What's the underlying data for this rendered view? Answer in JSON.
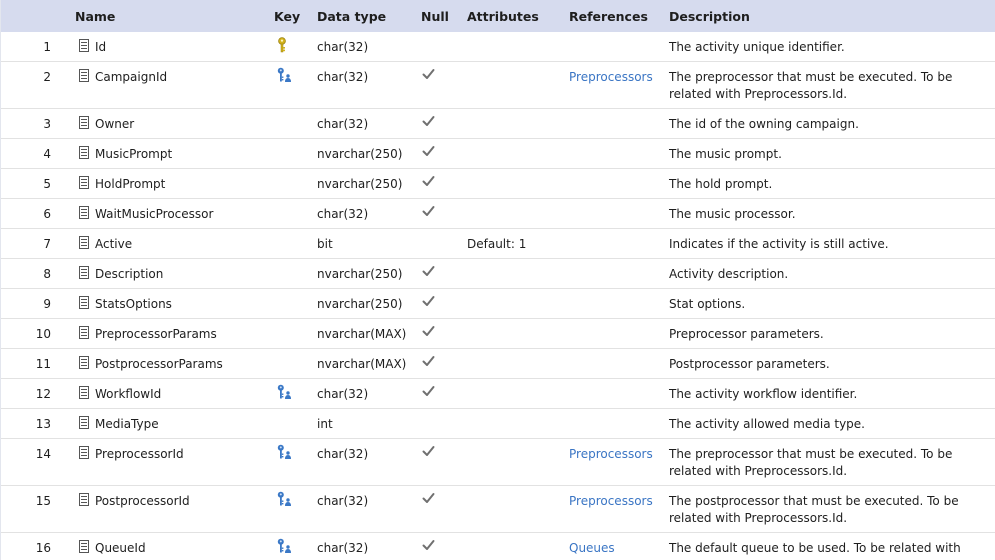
{
  "columns": {
    "name": "Name",
    "key": "Key",
    "data_type": "Data type",
    "null": "Null",
    "attributes": "Attributes",
    "references": "References",
    "description": "Description"
  },
  "colors": {
    "header_bg": "#d6dbee",
    "link": "#3a75c4",
    "primary_key": "#d2b21c",
    "foreign_key": "#3a78c6",
    "check": "#707070"
  },
  "rows": [
    {
      "num": "1",
      "name": "Id",
      "key": "primary-key-icon",
      "type": "char(32)",
      "nullable": false,
      "attr": "",
      "ref": "",
      "desc": "The activity unique identifier."
    },
    {
      "num": "2",
      "name": "CampaignId",
      "key": "foreign-key-icon",
      "type": "char(32)",
      "nullable": true,
      "attr": "",
      "ref": "Preprocessors",
      "desc": "The preprocessor that must be executed. To be related with Preprocessors.Id."
    },
    {
      "num": "3",
      "name": "Owner",
      "key": "",
      "type": "char(32)",
      "nullable": true,
      "attr": "",
      "ref": "",
      "desc": "The id of the owning campaign."
    },
    {
      "num": "4",
      "name": "MusicPrompt",
      "key": "",
      "type": "nvarchar(250)",
      "nullable": true,
      "attr": "",
      "ref": "",
      "desc": "The music prompt."
    },
    {
      "num": "5",
      "name": "HoldPrompt",
      "key": "",
      "type": "nvarchar(250)",
      "nullable": true,
      "attr": "",
      "ref": "",
      "desc": "The hold prompt."
    },
    {
      "num": "6",
      "name": "WaitMusicProcessor",
      "key": "",
      "type": "char(32)",
      "nullable": true,
      "attr": "",
      "ref": "",
      "desc": "The music processor."
    },
    {
      "num": "7",
      "name": "Active",
      "key": "",
      "type": "bit",
      "nullable": false,
      "attr": "Default: 1",
      "ref": "",
      "desc": "Indicates if the activity is still active."
    },
    {
      "num": "8",
      "name": "Description",
      "key": "",
      "type": "nvarchar(250)",
      "nullable": true,
      "attr": "",
      "ref": "",
      "desc": "Activity description."
    },
    {
      "num": "9",
      "name": "StatsOptions",
      "key": "",
      "type": "nvarchar(250)",
      "nullable": true,
      "attr": "",
      "ref": "",
      "desc": "Stat options."
    },
    {
      "num": "10",
      "name": "PreprocessorParams",
      "key": "",
      "type": "nvarchar(MAX)",
      "nullable": true,
      "attr": "",
      "ref": "",
      "desc": "Preprocessor parameters."
    },
    {
      "num": "11",
      "name": "PostprocessorParams",
      "key": "",
      "type": "nvarchar(MAX)",
      "nullable": true,
      "attr": "",
      "ref": "",
      "desc": "Postprocessor parameters."
    },
    {
      "num": "12",
      "name": "WorkflowId",
      "key": "foreign-key-icon",
      "type": "char(32)",
      "nullable": true,
      "attr": "",
      "ref": "",
      "desc": "The activity workflow identifier."
    },
    {
      "num": "13",
      "name": "MediaType",
      "key": "",
      "type": "int",
      "nullable": false,
      "attr": "",
      "ref": "",
      "desc": "The activity allowed media type."
    },
    {
      "num": "14",
      "name": "PreprocessorId",
      "key": "foreign-key-icon",
      "type": "char(32)",
      "nullable": true,
      "attr": "",
      "ref": "Preprocessors",
      "desc": "The preprocessor that must be executed. To be related with Preprocessors.Id."
    },
    {
      "num": "15",
      "name": "PostprocessorId",
      "key": "foreign-key-icon",
      "type": "char(32)",
      "nullable": true,
      "attr": "",
      "ref": "Preprocessors",
      "desc": "The postprocessor that must be executed. To be related with Preprocessors.Id."
    },
    {
      "num": "16",
      "name": "QueueId",
      "key": "foreign-key-icon",
      "type": "char(32)",
      "nullable": true,
      "attr": "",
      "ref": "Queues",
      "desc": "The default queue to be used. To be related with"
    }
  ]
}
